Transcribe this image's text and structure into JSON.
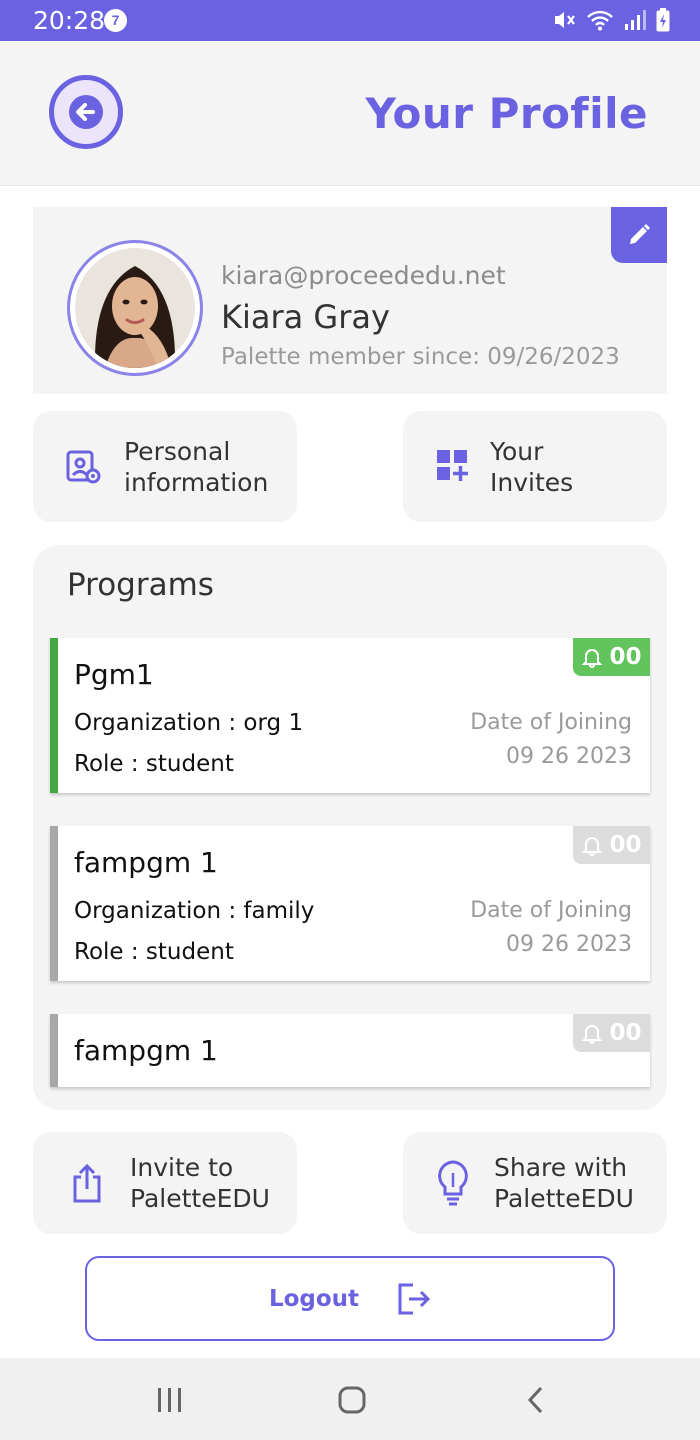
{
  "status_bar": {
    "time": "20:28",
    "notification_count": "7"
  },
  "header": {
    "title": "Your Profile",
    "back_icon": "arrow-left-icon"
  },
  "profile": {
    "email": "kiara@proceededu.net",
    "name": "Kiara Gray",
    "member_since": "Palette member since: 09/26/2023",
    "edit_icon": "pencil-icon"
  },
  "tiles": {
    "personal_info_line1": "Personal",
    "personal_info_line2": "information",
    "invites_line1": "Your",
    "invites_line2": "Invites",
    "invite_line1": "Invite to",
    "invite_line2": "PaletteEDU",
    "share_line1": "Share with",
    "share_line2": "PaletteEDU"
  },
  "programs": {
    "title": "Programs",
    "items": [
      {
        "name": "Pgm1",
        "organization": "Organization : org 1",
        "role": "Role : student",
        "doj_label": "Date of Joining",
        "doj_value": "09 26 2023",
        "notif": "00",
        "accent": "#43a843",
        "chip": "#62c45c"
      },
      {
        "name": "fampgm 1",
        "organization": "Organization : family",
        "role": "Role : student",
        "doj_label": "Date of Joining",
        "doj_value": "09 26 2023",
        "notif": "00",
        "accent": "#a8a8a8",
        "chip": "#dcdcdc"
      },
      {
        "name": "fampgm 1",
        "notif": "00",
        "accent": "#a8a8a8",
        "chip": "#dcdcdc"
      }
    ]
  },
  "logout": {
    "label": "Logout",
    "icon": "logout-icon"
  },
  "colors": {
    "primary": "#6a62e0",
    "tile_bg": "#f4f4f4"
  }
}
